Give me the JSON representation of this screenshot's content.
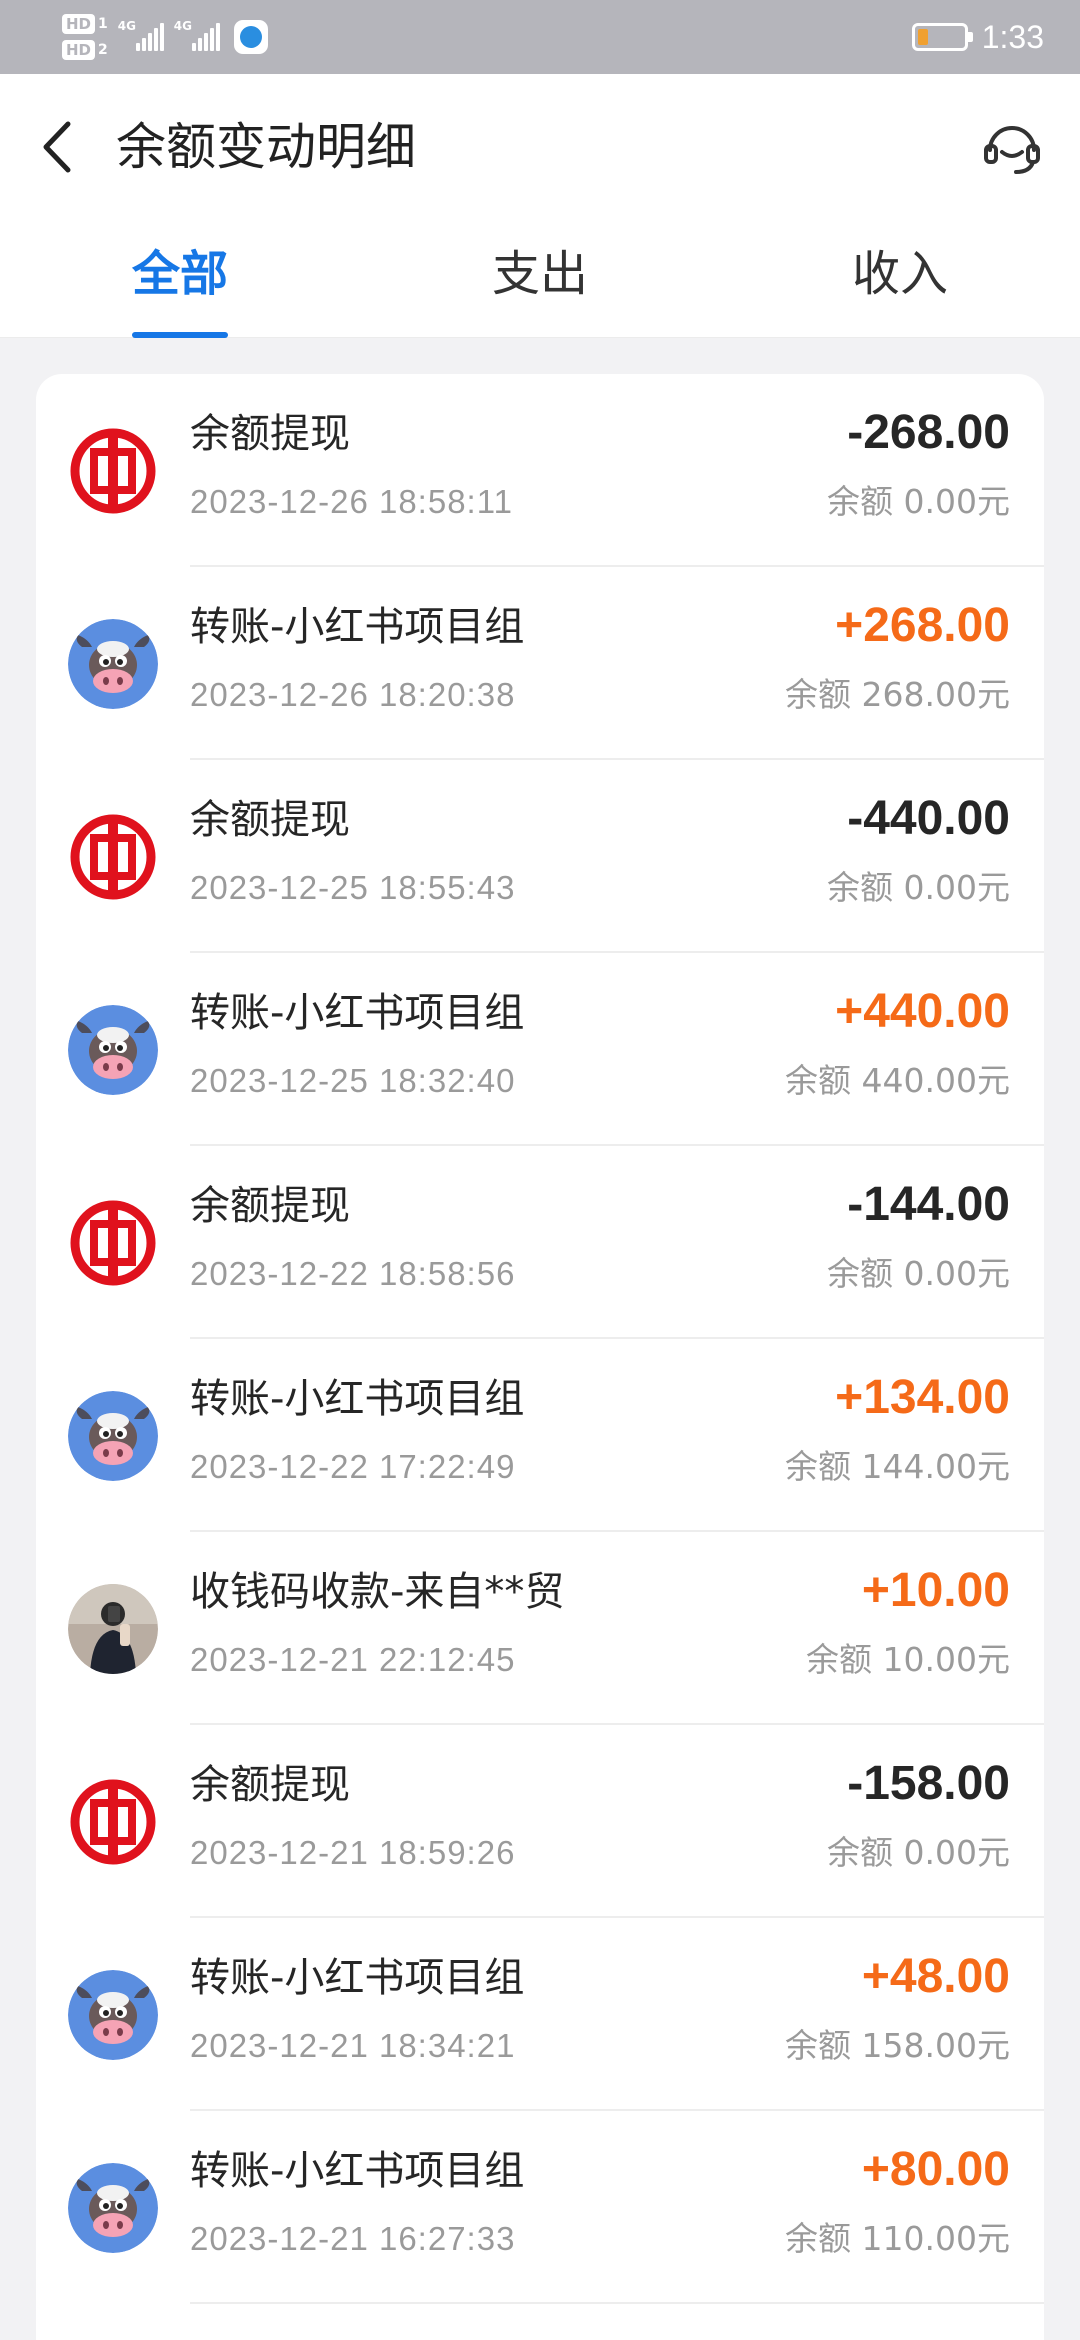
{
  "status_bar": {
    "sim1_label": "HD",
    "sim1_num": "1",
    "sim2_label": "HD",
    "sim2_num": "2",
    "net1": "4G",
    "net2": "4G",
    "time": "1:33"
  },
  "header": {
    "title": "余额变动明细"
  },
  "tabs": [
    {
      "label": "全部",
      "active": true
    },
    {
      "label": "支出",
      "active": false
    },
    {
      "label": "收入",
      "active": false
    }
  ],
  "balance_prefix": "余额 ",
  "transactions": [
    {
      "icon": "bank-logo-icon",
      "name": "余额提现",
      "time": "2023-12-26 18:58:11",
      "amount": "-268.00",
      "balance": "余额 0.00元",
      "positive": false
    },
    {
      "icon": "cow-avatar-icon",
      "name": "转账-小红书项目组",
      "time": "2023-12-26 18:20:38",
      "amount": "+268.00",
      "balance": "余额 268.00元",
      "positive": true
    },
    {
      "icon": "bank-logo-icon",
      "name": "余额提现",
      "time": "2023-12-25 18:55:43",
      "amount": "-440.00",
      "balance": "余额 0.00元",
      "positive": false
    },
    {
      "icon": "cow-avatar-icon",
      "name": "转账-小红书项目组",
      "time": "2023-12-25 18:32:40",
      "amount": "+440.00",
      "balance": "余额 440.00元",
      "positive": true
    },
    {
      "icon": "bank-logo-icon",
      "name": "余额提现",
      "time": "2023-12-22 18:58:56",
      "amount": "-144.00",
      "balance": "余额 0.00元",
      "positive": false
    },
    {
      "icon": "cow-avatar-icon",
      "name": "转账-小红书项目组",
      "time": "2023-12-22 17:22:49",
      "amount": "+134.00",
      "balance": "余额 144.00元",
      "positive": true
    },
    {
      "icon": "person-avatar-icon",
      "name": "收钱码收款-来自**贸",
      "time": "2023-12-21 22:12:45",
      "amount": "+10.00",
      "balance": "余额 10.00元",
      "positive": true
    },
    {
      "icon": "bank-logo-icon",
      "name": "余额提现",
      "time": "2023-12-21 18:59:26",
      "amount": "-158.00",
      "balance": "余额 0.00元",
      "positive": false
    },
    {
      "icon": "cow-avatar-icon",
      "name": "转账-小红书项目组",
      "time": "2023-12-21 18:34:21",
      "amount": "+48.00",
      "balance": "余额 158.00元",
      "positive": true
    },
    {
      "icon": "cow-avatar-icon",
      "name": "转账-小红书项目组",
      "time": "2023-12-21 16:27:33",
      "amount": "+80.00",
      "balance": "余额 110.00元",
      "positive": true
    }
  ],
  "colors": {
    "accent": "#1677e6",
    "positive_amount": "#f56a18",
    "bank_red": "#e0121d",
    "cow_bg": "#5b8ee0"
  }
}
